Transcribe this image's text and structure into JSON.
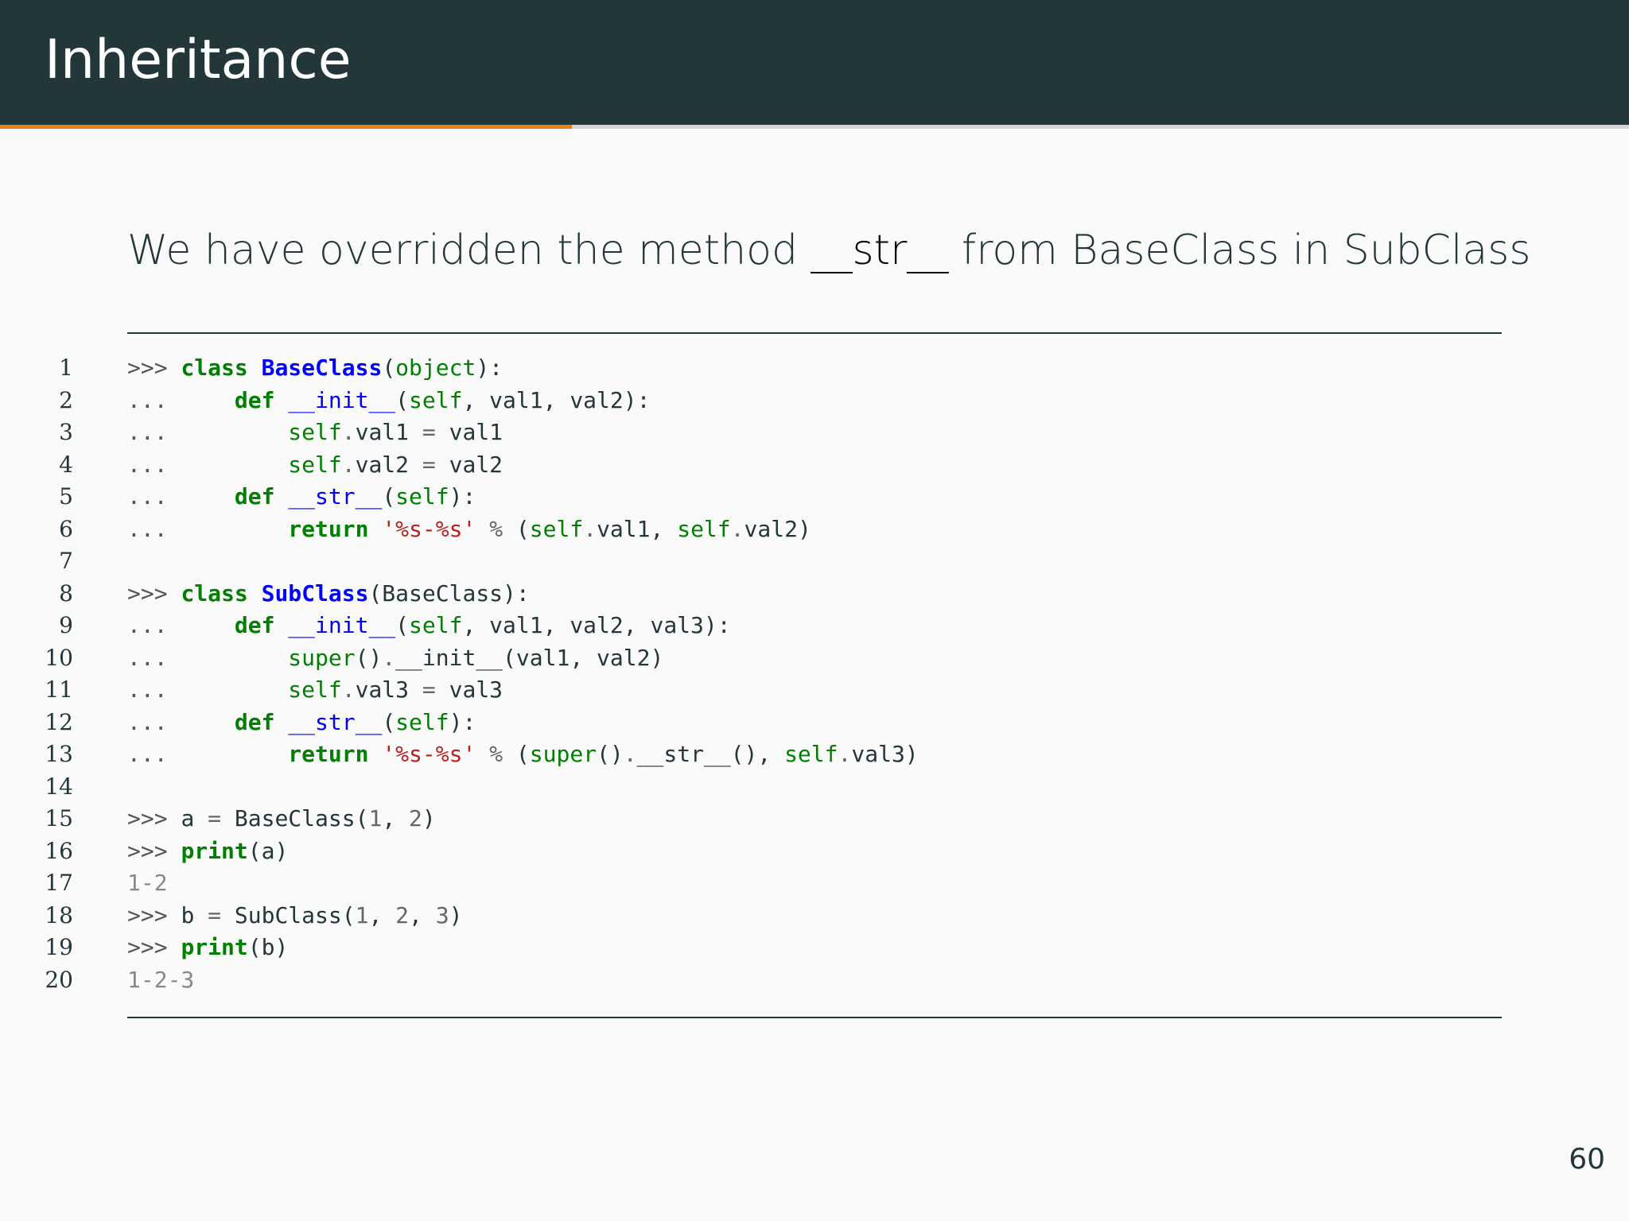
{
  "slide": {
    "title": "Inheritance",
    "progress": 0.351,
    "page_number": "60"
  },
  "subtitle": {
    "before": "We have overridden the method ",
    "emph": "__str__",
    "after": " from BaseClass in SubClass"
  },
  "code": {
    "lines": [
      {
        "num": "1",
        "tokens": [
          [
            "prompt",
            ">>> "
          ],
          [
            "kw",
            "class"
          ],
          [
            "plain",
            " "
          ],
          [
            "cls",
            "BaseClass"
          ],
          [
            "plain",
            "("
          ],
          [
            "builtin",
            "object"
          ],
          [
            "plain",
            "):"
          ]
        ]
      },
      {
        "num": "2",
        "tokens": [
          [
            "prompt",
            "...     "
          ],
          [
            "kw",
            "def"
          ],
          [
            "plain",
            " "
          ],
          [
            "fn",
            "__init__"
          ],
          [
            "plain",
            "("
          ],
          [
            "builtin",
            "self"
          ],
          [
            "plain",
            ", val1, val2):"
          ]
        ]
      },
      {
        "num": "3",
        "tokens": [
          [
            "prompt",
            "...         "
          ],
          [
            "builtin",
            "self"
          ],
          [
            "op",
            "."
          ],
          [
            "plain",
            "val1 "
          ],
          [
            "op",
            "="
          ],
          [
            "plain",
            " val1"
          ]
        ]
      },
      {
        "num": "4",
        "tokens": [
          [
            "prompt",
            "...         "
          ],
          [
            "builtin",
            "self"
          ],
          [
            "op",
            "."
          ],
          [
            "plain",
            "val2 "
          ],
          [
            "op",
            "="
          ],
          [
            "plain",
            " val2"
          ]
        ]
      },
      {
        "num": "5",
        "tokens": [
          [
            "prompt",
            "...     "
          ],
          [
            "kw",
            "def"
          ],
          [
            "plain",
            " "
          ],
          [
            "fn",
            "__str__"
          ],
          [
            "plain",
            "("
          ],
          [
            "builtin",
            "self"
          ],
          [
            "plain",
            "):"
          ]
        ]
      },
      {
        "num": "6",
        "tokens": [
          [
            "prompt",
            "...         "
          ],
          [
            "kw",
            "return"
          ],
          [
            "plain",
            " "
          ],
          [
            "str",
            "'%s-%s'"
          ],
          [
            "plain",
            " "
          ],
          [
            "op",
            "%"
          ],
          [
            "plain",
            " ("
          ],
          [
            "builtin",
            "self"
          ],
          [
            "op",
            "."
          ],
          [
            "plain",
            "val1, "
          ],
          [
            "builtin",
            "self"
          ],
          [
            "op",
            "."
          ],
          [
            "plain",
            "val2)"
          ]
        ]
      },
      {
        "num": "7",
        "tokens": []
      },
      {
        "num": "8",
        "tokens": [
          [
            "prompt",
            ">>> "
          ],
          [
            "kw",
            "class"
          ],
          [
            "plain",
            " "
          ],
          [
            "cls",
            "SubClass"
          ],
          [
            "plain",
            "(BaseClass):"
          ]
        ]
      },
      {
        "num": "9",
        "tokens": [
          [
            "prompt",
            "...     "
          ],
          [
            "kw",
            "def"
          ],
          [
            "plain",
            " "
          ],
          [
            "fn",
            "__init__"
          ],
          [
            "plain",
            "("
          ],
          [
            "builtin",
            "self"
          ],
          [
            "plain",
            ", val1, val2, val3):"
          ]
        ]
      },
      {
        "num": "10",
        "tokens": [
          [
            "prompt",
            "...         "
          ],
          [
            "builtin",
            "super"
          ],
          [
            "plain",
            "()"
          ],
          [
            "op",
            "."
          ],
          [
            "plain",
            "__init__(val1, val2)"
          ]
        ]
      },
      {
        "num": "11",
        "tokens": [
          [
            "prompt",
            "...         "
          ],
          [
            "builtin",
            "self"
          ],
          [
            "op",
            "."
          ],
          [
            "plain",
            "val3 "
          ],
          [
            "op",
            "="
          ],
          [
            "plain",
            " val3"
          ]
        ]
      },
      {
        "num": "12",
        "tokens": [
          [
            "prompt",
            "...     "
          ],
          [
            "kw",
            "def"
          ],
          [
            "plain",
            " "
          ],
          [
            "fn",
            "__str__"
          ],
          [
            "plain",
            "("
          ],
          [
            "builtin",
            "self"
          ],
          [
            "plain",
            "):"
          ]
        ]
      },
      {
        "num": "13",
        "tokens": [
          [
            "prompt",
            "...         "
          ],
          [
            "kw",
            "return"
          ],
          [
            "plain",
            " "
          ],
          [
            "str",
            "'%s-%s'"
          ],
          [
            "plain",
            " "
          ],
          [
            "op",
            "%"
          ],
          [
            "plain",
            " ("
          ],
          [
            "builtin",
            "super"
          ],
          [
            "plain",
            "()"
          ],
          [
            "op",
            "."
          ],
          [
            "plain",
            "__str__(), "
          ],
          [
            "builtin",
            "self"
          ],
          [
            "op",
            "."
          ],
          [
            "plain",
            "val3)"
          ]
        ]
      },
      {
        "num": "14",
        "tokens": []
      },
      {
        "num": "15",
        "tokens": [
          [
            "prompt",
            ">>> "
          ],
          [
            "plain",
            "a "
          ],
          [
            "op",
            "="
          ],
          [
            "plain",
            " BaseClass("
          ],
          [
            "num",
            "1"
          ],
          [
            "plain",
            ", "
          ],
          [
            "num",
            "2"
          ],
          [
            "plain",
            ")"
          ]
        ]
      },
      {
        "num": "16",
        "tokens": [
          [
            "prompt",
            ">>> "
          ],
          [
            "kw",
            "print"
          ],
          [
            "plain",
            "(a)"
          ]
        ]
      },
      {
        "num": "17",
        "tokens": [
          [
            "out",
            "1-2"
          ]
        ]
      },
      {
        "num": "18",
        "tokens": [
          [
            "prompt",
            ">>> "
          ],
          [
            "plain",
            "b "
          ],
          [
            "op",
            "="
          ],
          [
            "plain",
            " SubClass("
          ],
          [
            "num",
            "1"
          ],
          [
            "plain",
            ", "
          ],
          [
            "num",
            "2"
          ],
          [
            "plain",
            ", "
          ],
          [
            "num",
            "3"
          ],
          [
            "plain",
            ")"
          ]
        ]
      },
      {
        "num": "19",
        "tokens": [
          [
            "prompt",
            ">>> "
          ],
          [
            "kw",
            "print"
          ],
          [
            "plain",
            "(b)"
          ]
        ]
      },
      {
        "num": "20",
        "tokens": [
          [
            "out",
            "1-2-3"
          ]
        ]
      }
    ]
  },
  "colors": {
    "title_bar": "#23373b",
    "accent": "#eb811b",
    "keyword": "#008000",
    "class_name": "#0000ff",
    "string": "#ba2121"
  }
}
